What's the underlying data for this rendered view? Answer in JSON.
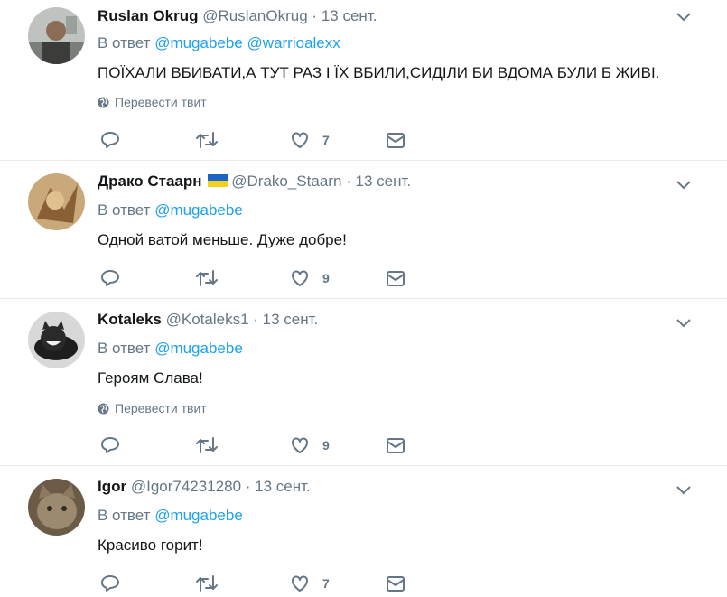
{
  "ui": {
    "reply_prefix": "В ответ",
    "translate_label": "Перевести твит",
    "colors": {
      "link": "#1da1f2",
      "muted": "#657786",
      "text": "#14171a",
      "divider": "#e6ecf0"
    }
  },
  "tweets": [
    {
      "name": "Ruslan Okrug",
      "handle": "@RuslanOkrug",
      "time": "13 сент.",
      "reply_to": [
        "@mugabebe",
        "@warrioalexx"
      ],
      "text": "ПОЇХАЛИ ВБИВАТИ,А ТУТ РАЗ І ЇХ ВБИЛИ,СИДІЛИ БИ  ВДОМА БУЛИ Б ЖИВІ.",
      "likes": "7",
      "flag": false,
      "translate": true
    },
    {
      "name": "Драко Стаарн",
      "handle": "@Drako_Staarn",
      "time": "13 сент.",
      "reply_to": [
        "@mugabebe"
      ],
      "text": "Одной ватой меньше. Дуже добре!",
      "likes": "9",
      "flag": true,
      "translate": false
    },
    {
      "name": "Kotaleks",
      "handle": "@Kotaleks1",
      "time": "13 сент.",
      "reply_to": [
        "@mugabebe"
      ],
      "text": "Героям Слава!",
      "likes": "9",
      "flag": false,
      "translate": true
    },
    {
      "name": "Igor",
      "handle": "@Igor74231280",
      "time": "13 сент.",
      "reply_to": [
        "@mugabebe"
      ],
      "text": "Красиво горит!",
      "likes": "7",
      "flag": false,
      "translate": false
    }
  ]
}
